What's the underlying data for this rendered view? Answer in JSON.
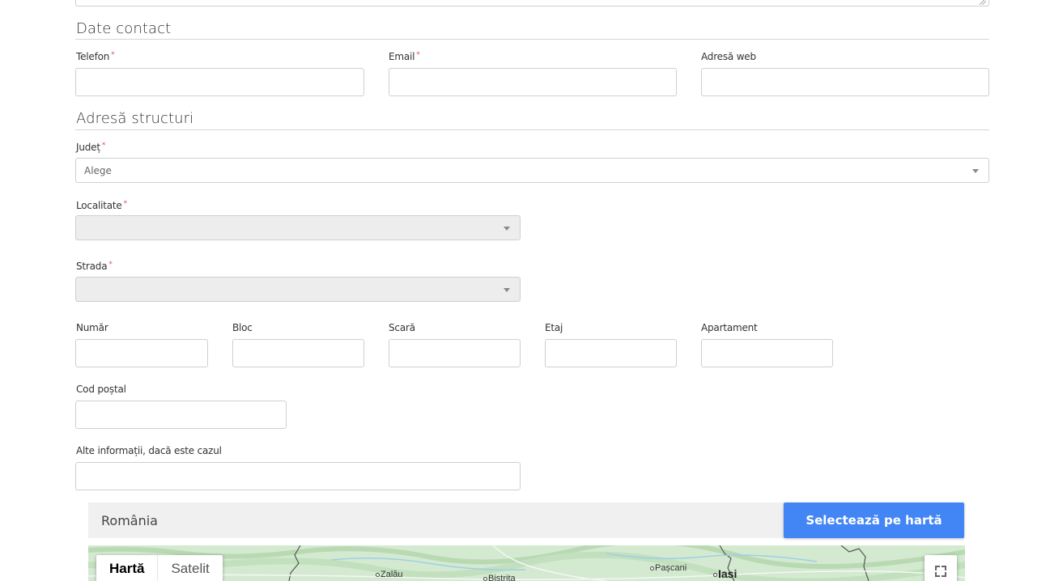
{
  "contact": {
    "title": "Date contact",
    "phone_label": "Telefon",
    "email_label": "Email",
    "web_label": "Adresă web",
    "required_mark": "*"
  },
  "address": {
    "title": "Adresă structuri",
    "county_label": "Județ",
    "county_value": "Alege",
    "locality_label": "Localitate",
    "street_label": "Strada",
    "number_label": "Număr",
    "block_label": "Bloc",
    "stair_label": "Scară",
    "floor_label": "Etaj",
    "apartment_label": "Apartament",
    "postal_label": "Cod poștal",
    "other_label": "Alte informații, dacă este cazul"
  },
  "map": {
    "search_value": "România",
    "select_button": "Selectează pe hartă",
    "type_map": "Hartă",
    "type_satellite": "Satelit",
    "towns": [
      "Zalău",
      "Bistrita",
      "Pașcani",
      "Iasi"
    ],
    "colors": {
      "button": "#4285f4",
      "land": "#cfe8cf"
    }
  }
}
